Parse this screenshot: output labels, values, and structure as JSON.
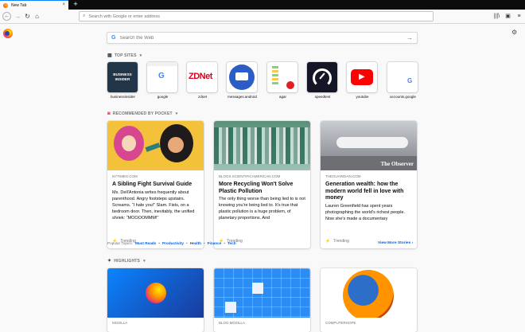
{
  "tab": {
    "title": "New Tab",
    "close": "×",
    "new_tab": "+"
  },
  "nav": {
    "back": "←",
    "forward": "→",
    "reload": "↻",
    "home": "⌂",
    "url_placeholder": "Search with Google or enter address",
    "library": "|||\\",
    "sidebar": "▣",
    "menu": "≡"
  },
  "search": {
    "placeholder": "Search the Web",
    "engine_icon": "G",
    "arrow": "→"
  },
  "top_sites": {
    "heading": "TOP SITES",
    "sites": [
      {
        "label": "businessinsider",
        "tile_text": "BUSINESS INSIDER",
        "color": "#22364a"
      },
      {
        "label": "google",
        "tile_text": "G",
        "color": "#ffffff"
      },
      {
        "label": "zdnet",
        "tile_text": "ZDNet",
        "color": "#ffffff"
      },
      {
        "label": "messages.android",
        "tile_text": "",
        "color": "#2c5cc5"
      },
      {
        "label": "agar",
        "tile_text": "",
        "color": "#ffffff"
      },
      {
        "label": "speedtest",
        "tile_text": "",
        "color": "#141526"
      },
      {
        "label": "youtube",
        "tile_text": "▶",
        "color": "#ff0000"
      },
      {
        "label": "accounts.google",
        "tile_text": "G",
        "color": "#ffffff"
      }
    ]
  },
  "pocket": {
    "heading": "RECOMMENDED BY POCKET",
    "cards": [
      {
        "source": "NYTIMES.COM",
        "title": "A Sibling Fight Survival Guide",
        "description": "Ms. Dell'Antonia writes frequently about parenthood. Angry footsteps upstairs. Screams. “I hate you!” Slam. Fists, on a bedroom door. Then, inevitably, the unified shriek: “MOOOOMMM!”",
        "context": "Trending"
      },
      {
        "source": "BLOGS.SCIENTIFICAMERICAN.COM",
        "title": "More Recycling Won't Solve Plastic Pollution",
        "description": "The only thing worse than being lied to is not knowing you're being lied to. It's true that plastic pollution is a huge problem, of planetary proportions. And",
        "context": "Trending"
      },
      {
        "source": "THEGUARDIAN.COM",
        "title": "Generation wealth: how the modern world fell in love with money",
        "description": "Lauren Greenfield has spent years photographing the world's richest people. Now she's made a documentary",
        "context": "Trending",
        "image_caption": "The Observer"
      }
    ],
    "topics_label": "Popular Topics:",
    "topics": [
      "Must Reads",
      "Productivity",
      "Health",
      "Finance",
      "Tech"
    ],
    "more": "View More Stories"
  },
  "highlights": {
    "heading": "HIGHLIGHTS",
    "cards": [
      {
        "source": "MOZILLA"
      },
      {
        "source": "BLOG.MOZILLA"
      },
      {
        "source": "COMPUTERHOPE"
      }
    ]
  },
  "colors": {
    "accent": "#0a84ff",
    "link": "#0060df"
  }
}
